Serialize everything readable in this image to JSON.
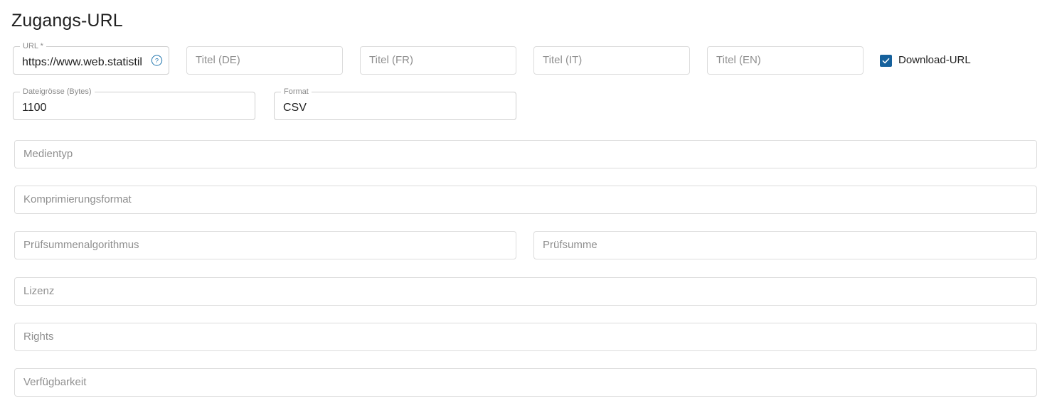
{
  "section": {
    "title": "Zugangs-URL"
  },
  "row1": {
    "url": {
      "label": "URL",
      "required_marker": " *",
      "value": "https://www.web.statistil",
      "help_icon": "help-circle-icon"
    },
    "title_de": {
      "placeholder": "Titel (DE)"
    },
    "title_fr": {
      "placeholder": "Titel (FR)"
    },
    "title_it": {
      "placeholder": "Titel (IT)"
    },
    "title_en": {
      "placeholder": "Titel (EN)"
    },
    "download_url": {
      "label": "Download-URL",
      "checked": true,
      "icon": "checkmark-icon",
      "color": "#16619c"
    }
  },
  "row2": {
    "filesize": {
      "label": "Dateigrösse (Bytes)",
      "value": "1100"
    },
    "format": {
      "label": "Format",
      "value": "CSV"
    }
  },
  "fields": {
    "medientyp": {
      "placeholder": "Medientyp"
    },
    "komprimierungsformat": {
      "placeholder": "Komprimierungsformat"
    },
    "pruefsummenalgorithmus": {
      "placeholder": "Prüfsummenalgorithmus"
    },
    "pruefsumme": {
      "placeholder": "Prüfsumme"
    },
    "lizenz": {
      "placeholder": "Lizenz"
    },
    "rights": {
      "placeholder": "Rights"
    },
    "verfuegbarkeit": {
      "placeholder": "Verfügbarkeit"
    }
  }
}
